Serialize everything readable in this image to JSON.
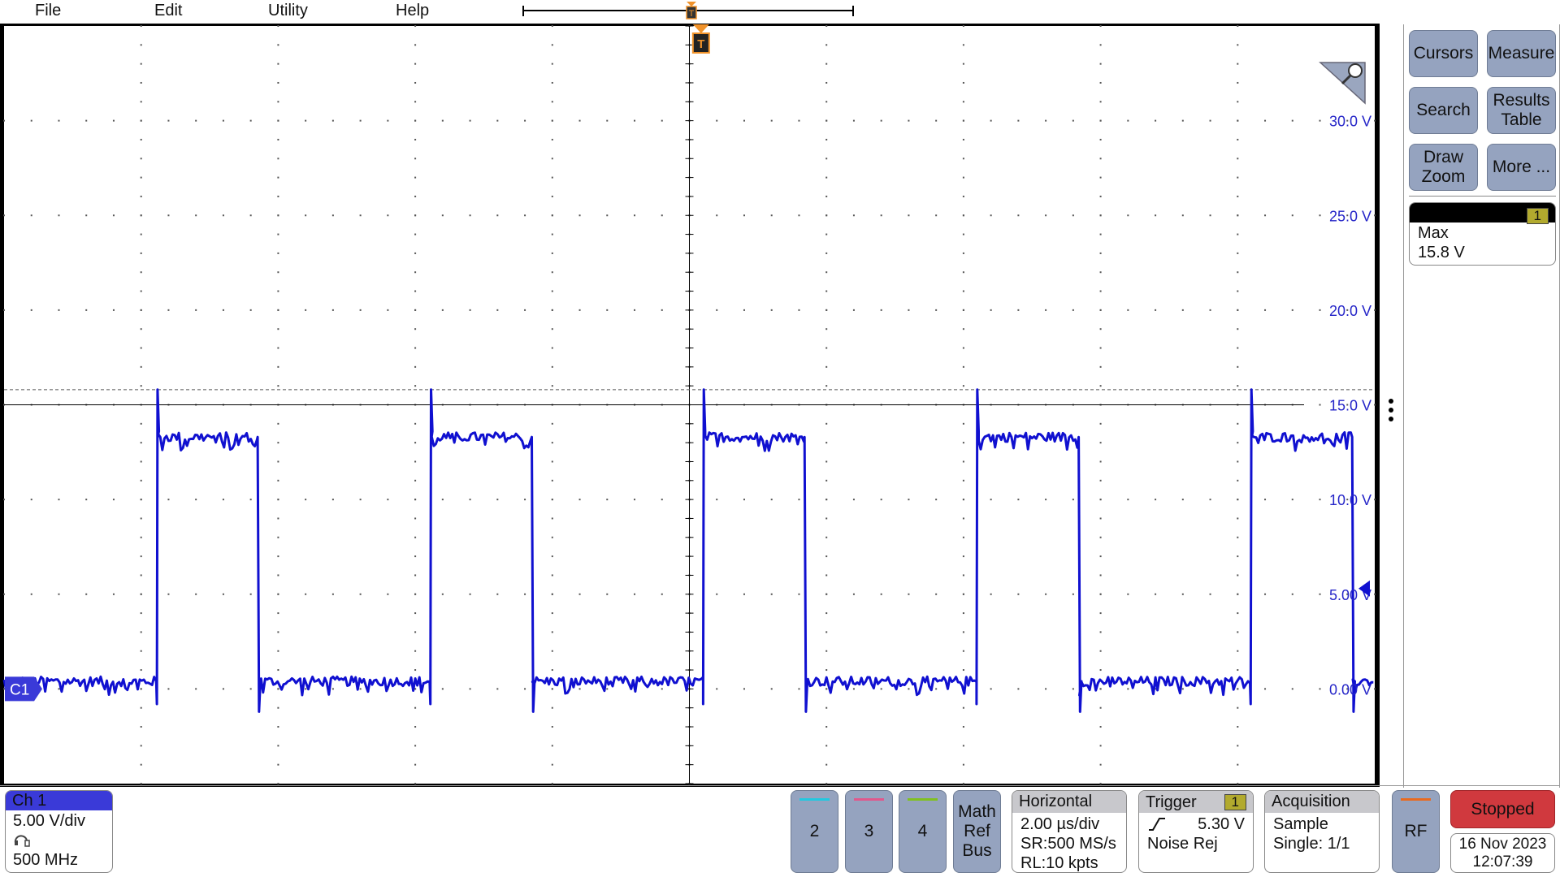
{
  "menu": [
    "File",
    "Edit",
    "Utility",
    "Help"
  ],
  "right_panel": {
    "buttons": [
      [
        "Cursors"
      ],
      [
        "Measure"
      ],
      [
        "Search"
      ],
      [
        "Results",
        "Table"
      ],
      [
        "Draw",
        "Zoom"
      ],
      [
        "More ..."
      ]
    ],
    "measurement": {
      "source": "1",
      "label": "Max",
      "value": "15.8 V"
    }
  },
  "channel": {
    "name": "Ch 1",
    "scale": "5.00 V/div",
    "bandwidth": "500 MHz",
    "marker": "C1",
    "color": "#3a3ad8"
  },
  "channel_buttons": [
    {
      "label": "2",
      "color": "#22c8e0"
    },
    {
      "label": "3",
      "color": "#e0588c"
    },
    {
      "label": "4",
      "color": "#80c020"
    }
  ],
  "math_button": [
    "Math",
    "Ref",
    "Bus"
  ],
  "horizontal": {
    "title": "Horizontal",
    "scale": "2.00 µs/div",
    "sample_rate": "SR:500 MS/s",
    "record_length": "RL:10 kpts"
  },
  "trigger": {
    "title": "Trigger",
    "source": "1",
    "level": "5.30 V",
    "mode": "Noise Rej",
    "slope": "rising-edge-icon"
  },
  "acquisition": {
    "title": "Acquisition",
    "mode": "Sample",
    "count": "Single: 1/1"
  },
  "rf": {
    "label": "RF",
    "color": "#e86a20"
  },
  "status": {
    "label": "Stopped",
    "color": "#d0393e"
  },
  "datetime": {
    "date": "16 Nov 2023",
    "time": "12:07:39"
  },
  "chart_data": {
    "type": "line",
    "y_tick_labels": [
      "30.0 V",
      "25.0 V",
      "20.0 V",
      "15.0 V",
      "10.0 V",
      "5.00 V",
      "0.00 V"
    ],
    "y_ticks": [
      30,
      25,
      20,
      15,
      10,
      5,
      0
    ],
    "xlim_us": [
      -10,
      10
    ],
    "ylim_V": [
      -5,
      35
    ],
    "grid": "dotted",
    "series": [
      {
        "color": "#1010d0",
        "high_V": 13.3,
        "low_V": 0.4,
        "overshoot_V": 15.8,
        "rising_edges_us": [
          -7.77,
          -3.78,
          0.2,
          4.19,
          8.19
        ],
        "falling_edges_us": [
          -6.3,
          -2.3,
          1.68,
          5.68,
          9.67
        ]
      }
    ],
    "max_line_V": 15.8,
    "trigger_level_V": 5.3,
    "trigger_time_us": 0.17
  }
}
